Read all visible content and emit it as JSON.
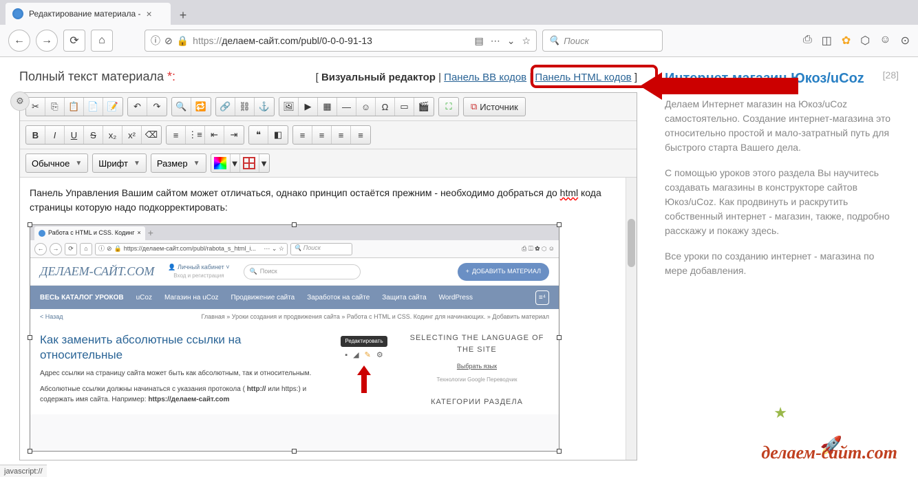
{
  "browser": {
    "tab_title": "Редактирование материала -",
    "url_display": "делаем-сайт.com/publ/0-0-0-91-13",
    "url_scheme": "https://",
    "search_placeholder": "Поиск"
  },
  "page": {
    "title": "Полный текст материала",
    "required_mark": "*:",
    "tabs": {
      "visual": "Визуальный редактор",
      "bb": "Панель BB кодов",
      "html": "Панель HTML кодов"
    }
  },
  "toolbar": {
    "source": "Источник",
    "format": "Обычное",
    "font": "Шрифт",
    "size": "Размер"
  },
  "editor_text": {
    "line1a": "Панель Управления Вашим сайтом может отличаться, однако принцип остаётся прежним - необходимо добраться до ",
    "line1b": "html",
    "line1c": " кода страницы которую надо подкорректировать:"
  },
  "inner": {
    "tab": "Работа с HTML и CSS. Кодинг",
    "url": "https://делаем-сайт.com/publ/rabota_s_html_i...",
    "search": "Поиск",
    "logo": "ДЕЛАЕМ-САЙТ.COM",
    "account": "Личный кабинет",
    "account_sub": "Вход и регистрация",
    "search_ph": "Поиск",
    "add_btn": "ДОБАВИТЬ МАТЕРИАЛ",
    "menu": [
      "ВЕСЬ КАТАЛОГ УРОКОВ",
      "uCoz",
      "Магазин на uCoz",
      "Продвижение сайта",
      "Заработок на сайте",
      "Защита сайта",
      "WordPress"
    ],
    "back": "< Назад",
    "breadcrumb": "Главная » Уроки создания и продвижения сайта » Работа с HTML и CSS. Кодинг для начинающих. » Добавить материал",
    "article_title": "Как заменить абсолютные ссылки на относительные",
    "tooltip": "Редактировать",
    "right_title": "SELECTING THE LANGUAGE OF THE SITE",
    "right_sub": "Выбрать язык",
    "right_trans": "Технологии Google Переводчик",
    "right_cat": "КАТЕГОРИИ РАЗДЕЛА",
    "p1": "Адрес ссылки на страницу сайта может быть как абсолютным, так и относительным.",
    "p2a": "Абсолютные ссылки должны начинаться с указания протокола ( ",
    "p2b": "http://",
    "p2c": " или https:) и содержать имя сайта. Например: ",
    "p2d": "https://делаем-сайт.com"
  },
  "side": {
    "title": "Интернет магазин Юкоз/uCoz",
    "count": "[28]",
    "p1": "Делаем Интернет магазин на Юкоз/uCoz самостоятельно. Создание интернет-магазина это относительно простой и мало-затратный путь для быстрого старта Вашего дела.",
    "p2": "С помощью уроков этого раздела Вы научитесь создавать магазины в конструкторе сайтов Юкоз/uCoz. Как продвинуть и раскрутить собственный интернет - магазин, также, подробно расскажу и покажу здесь.",
    "p3": "Все уроки по созданию интернет - магазина по мере добавления.",
    "logo": "делаем-сайт.com"
  },
  "status": "javascript://"
}
